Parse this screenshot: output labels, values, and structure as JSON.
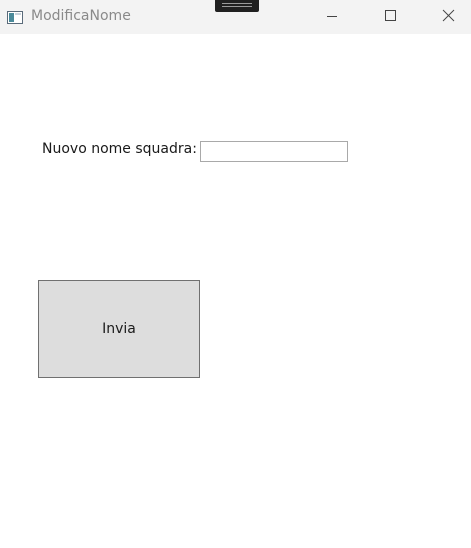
{
  "window": {
    "title": "ModificaNome"
  },
  "form": {
    "label": "Nuovo nome squadra:",
    "input_value": "",
    "submit_label": "Invia"
  },
  "colors": {
    "titlebar_bg": "#f3f3f3",
    "title_text": "#8a8a8a",
    "button_bg": "#dddddd",
    "button_border": "#707070",
    "input_border": "#a9a9a9"
  },
  "icons": {
    "app": "app-window-icon",
    "minimize": "minimize-icon",
    "maximize": "maximize-icon",
    "close": "close-icon"
  }
}
